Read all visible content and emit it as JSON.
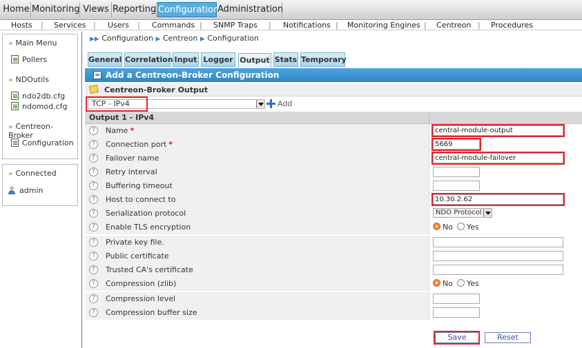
{
  "top_menu": [
    {
      "label": "Home",
      "active": false
    },
    {
      "label": "Monitoring",
      "active": false
    },
    {
      "label": "Views",
      "active": false
    },
    {
      "label": "Reporting",
      "active": false
    },
    {
      "label": "Configuration",
      "active": true
    },
    {
      "label": "Administration",
      "active": false
    }
  ],
  "sub_menu": [
    "Hosts",
    "Services",
    "Users",
    "Commands",
    "SNMP Traps",
    "Notifications",
    "Monitoring Engines",
    "Centreon",
    "Procedures"
  ],
  "sub_menu_separator": "|",
  "left_menu": {
    "main_menu": "Main Menu",
    "pollers": "Pollers",
    "ndoutils": "NDOutils",
    "ndo2db": "ndo2db.cfg",
    "ndomod": "ndomod.cfg",
    "centreon_broker": "Centreon-Broker",
    "configuration": "Configuration"
  },
  "connected_box": {
    "title": "Connected",
    "user": "admin"
  },
  "breadcrumb": [
    "Configuration",
    "Centreon",
    "Configuration"
  ],
  "tabs": [
    {
      "label": "General",
      "active": false
    },
    {
      "label": "Correlation",
      "active": false
    },
    {
      "label": "Input",
      "active": false
    },
    {
      "label": "Logger",
      "active": false
    },
    {
      "label": "Output",
      "active": true
    },
    {
      "label": "Stats",
      "active": false
    },
    {
      "label": "Temporary",
      "active": false
    }
  ],
  "form_title": "Add a Centreon-Broker Configuration",
  "section_title": "Centreon-Broker Output",
  "output_type_select": "TCP - IPv4",
  "add_label": "Add",
  "table_header": "Output 1 - IPv4",
  "fields": [
    {
      "label": "Name",
      "required": true,
      "type": "text",
      "value": "central-module-output"
    },
    {
      "label": "Connection port",
      "required": true,
      "type": "text",
      "value": "5669"
    },
    {
      "label": "Failover name",
      "required": false,
      "type": "text",
      "value": "central-module-failover"
    },
    {
      "label": "Retry interval",
      "required": false,
      "type": "text",
      "value": ""
    },
    {
      "label": "Buffering timeout",
      "required": false,
      "type": "text",
      "value": ""
    },
    {
      "label": "Host to connect to",
      "required": false,
      "type": "text",
      "value": "10.30.2.62"
    },
    {
      "label": "Serialization protocol",
      "required": false,
      "type": "select",
      "value": "NDO Protocol"
    },
    {
      "label": "Enable TLS encryption",
      "required": false,
      "type": "radio",
      "value": "No"
    },
    {
      "label": "Private key file.",
      "required": false,
      "type": "text",
      "value": ""
    },
    {
      "label": "Public certificate",
      "required": false,
      "type": "text",
      "value": ""
    },
    {
      "label": "Trusted CA's certificate",
      "required": false,
      "type": "text",
      "value": ""
    },
    {
      "label": "Compression (zlib)",
      "required": false,
      "type": "radio",
      "value": "No"
    },
    {
      "label": "Compression level",
      "required": false,
      "type": "text",
      "value": ""
    },
    {
      "label": "Compression buffer size",
      "required": false,
      "type": "text",
      "value": ""
    }
  ],
  "radio_no": "No",
  "radio_yes": "Yes",
  "required_mark": "*",
  "help_glyph": "?",
  "buttons": {
    "save": "Save",
    "reset": "Reset"
  },
  "colors": {
    "accent": "#55aee0",
    "highlight": "#e2242c",
    "title_bar": "#2c86c6"
  }
}
